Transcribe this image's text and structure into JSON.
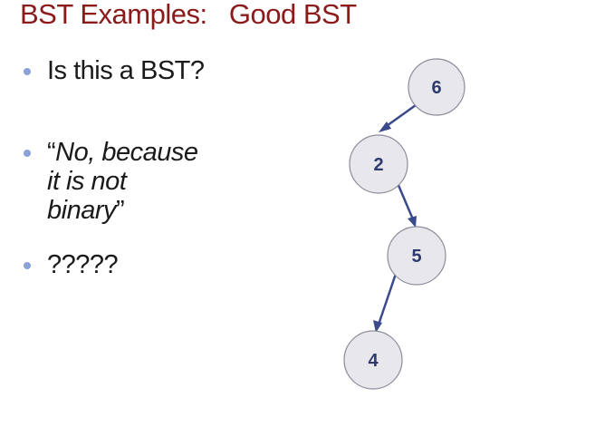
{
  "slide": {
    "title": "BST Examples:   Good BST",
    "bullets": [
      {
        "text": "Is this a BST?"
      },
      {
        "quote_open": "“",
        "lines": [
          "No, because",
          "it is not",
          "binary"
        ],
        "quote_close": "”"
      },
      {
        "text": "?????"
      }
    ]
  },
  "tree": {
    "nodes": [
      {
        "id": "n6",
        "label": "6"
      },
      {
        "id": "n2",
        "label": "2"
      },
      {
        "id": "n5",
        "label": "5"
      },
      {
        "id": "n4",
        "label": "4"
      }
    ],
    "edges": [
      {
        "from": "6",
        "to": "2"
      },
      {
        "from": "2",
        "to": "5"
      },
      {
        "from": "5",
        "to": "4"
      }
    ]
  },
  "colors": {
    "title": "#8b1a1a",
    "bullet_dot": "#8aa2d8",
    "edge": "#3b4a8c",
    "node_fill": "#e8e8ec",
    "node_label": "#2e3a6e"
  }
}
